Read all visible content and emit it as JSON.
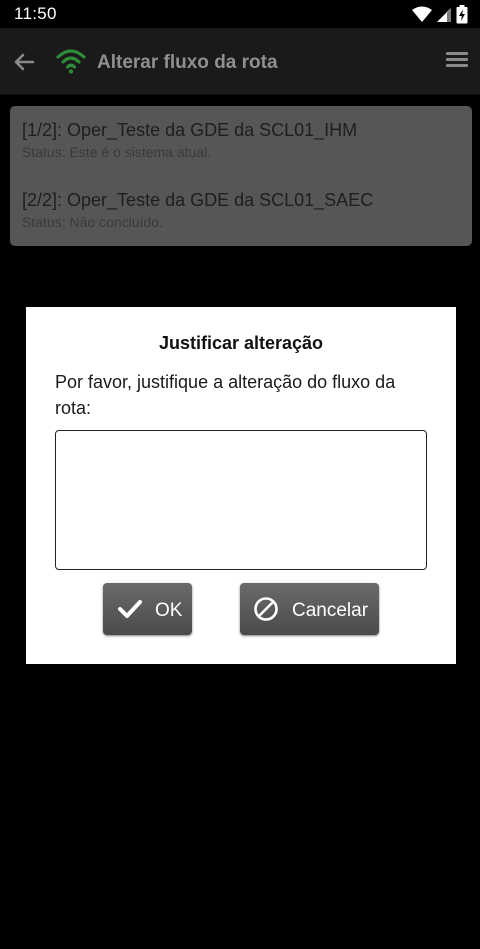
{
  "status_bar": {
    "time": "11:50",
    "icons": [
      "wifi-icon",
      "signal-icon",
      "battery-icon"
    ]
  },
  "app_bar": {
    "title": "Alterar fluxo da rota",
    "back_icon": "arrow-left-icon",
    "connection_icon": "wifi-icon",
    "menu_icon": "hamburger-menu-icon",
    "connection_color": "#2e8b3a"
  },
  "route_list": {
    "items": [
      {
        "title": "[1/2]: Oper_Teste da GDE da SCL01_IHM",
        "status": "Status: Este é o sistema atual."
      },
      {
        "title": "[2/2]: Oper_Teste da GDE da SCL01_SAEC",
        "status": "Status: Não concluído."
      }
    ]
  },
  "dialog": {
    "title": "Justificar alteração",
    "message": "Por favor, justifique a alteração do fluxo da rota:",
    "input_value": "",
    "ok_label": "OK",
    "ok_icon": "check-icon",
    "cancel_label": "Cancelar",
    "cancel_icon": "prohibited-icon"
  }
}
